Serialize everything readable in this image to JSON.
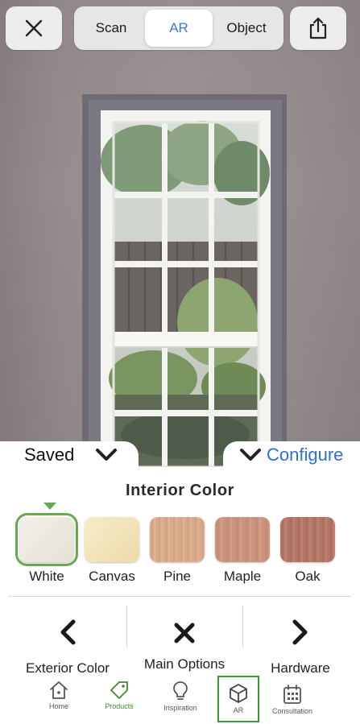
{
  "top_bar": {
    "close_icon": "close-icon",
    "share_icon": "share-icon",
    "modes": [
      {
        "label": "Scan",
        "active": false
      },
      {
        "label": "AR",
        "active": true
      },
      {
        "label": "Object",
        "active": false
      }
    ]
  },
  "sheet_tabs": {
    "saved_label": "Saved",
    "configure_label": "Configure"
  },
  "panel": {
    "title": "Interior Color",
    "swatches": [
      {
        "label": "White",
        "color": "#ece9df",
        "selected": true
      },
      {
        "label": "Canvas",
        "color": "#f3e5bd",
        "selected": false
      },
      {
        "label": "Pine",
        "color": "#d7a98a",
        "selected": false
      },
      {
        "label": "Maple",
        "color": "#c9917a",
        "selected": false
      },
      {
        "label": "Oak",
        "color": "#b27565",
        "selected": false
      }
    ],
    "nav": {
      "prev_label": "Exterior Color",
      "main_label": "Main Options",
      "next_label": "Hardware"
    }
  },
  "tab_bar": {
    "items": [
      {
        "label": "Home",
        "icon": "home-icon"
      },
      {
        "label": "Products",
        "icon": "tag-icon"
      },
      {
        "label": "Inspiration",
        "icon": "lightbulb-icon"
      },
      {
        "label": "AR",
        "icon": "cube-icon",
        "active": true
      },
      {
        "label": "Consultation",
        "icon": "calendar-icon"
      }
    ]
  },
  "colors": {
    "accent_blue": "#2f6fd6",
    "selected_green": "#6aa84f"
  }
}
